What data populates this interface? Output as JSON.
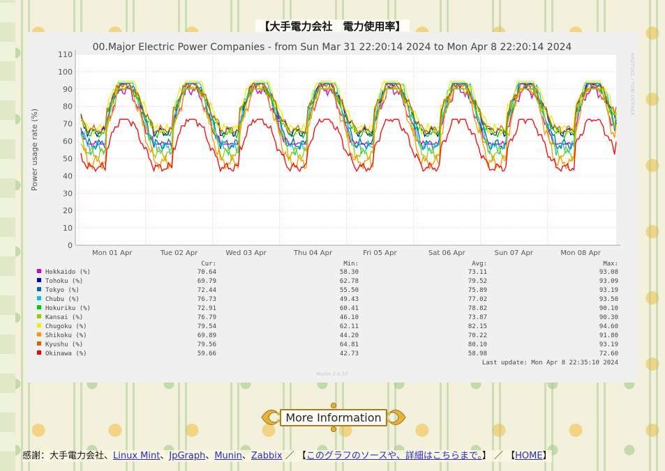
{
  "page": {
    "title": "【大手電力会社　電力使用率】",
    "more_info_label": "More Information"
  },
  "footer": {
    "thanks_label": "感謝：大手電力会社、",
    "links": [
      "Linux Mint",
      "JpGraph",
      "Munin",
      "Zabbix"
    ],
    "separator": "、",
    "slash": " ／ ",
    "source_link": "このグラフのソースや、詳細はこちらまで。",
    "home_link": "HOME",
    "bracket_open": "【",
    "bracket_close": "】"
  },
  "chart_data": {
    "type": "line",
    "title": "00.Major Electric Power Companies - from Sun Mar 31 22:20:14 2024 to Mon Apr  8 22:20:14 2024",
    "xlabel": "",
    "ylabel": "Power usage rate (%)",
    "ylim": [
      0,
      110
    ],
    "yticks": [
      0,
      10,
      20,
      30,
      40,
      50,
      60,
      70,
      80,
      90,
      100,
      110
    ],
    "xticks": [
      "Mon 01 Apr",
      "Tue 02 Apr",
      "Wed 03 Apr",
      "Thu 04 Apr",
      "Fri 05 Apr",
      "Sat 06 Apr",
      "Sun 07 Apr",
      "Mon 08 Apr"
    ],
    "grid": true,
    "side_label": "RRDTOOL / TOBI OETIKER",
    "footer_label": "Munin 2.0.57",
    "legend_headers": [
      "Cur:",
      "Min:",
      "Avg:",
      "Max:"
    ],
    "last_update": "Last update: Mon Apr  8 22:35:10 2024",
    "series": [
      {
        "name": "Hokkaido (%)",
        "color": "#cc00cc",
        "cur": "70.64",
        "min": "58.30",
        "avg": "73.11",
        "max": "93.08"
      },
      {
        "name": "Tohoku (%)",
        "color": "#0000cc",
        "cur": "69.79",
        "min": "62.78",
        "avg": "79.52",
        "max": "93.09"
      },
      {
        "name": "Tokyo (%)",
        "color": "#0066b3",
        "cur": "72.44",
        "min": "55.50",
        "avg": "75.89",
        "max": "93.19"
      },
      {
        "name": "Chubu (%)",
        "color": "#00cccc",
        "cur": "76.73",
        "min": "49.43",
        "avg": "77.02",
        "max": "93.50"
      },
      {
        "name": "Hokuriku (%)",
        "color": "#00cc00",
        "cur": "72.91",
        "min": "60.41",
        "avg": "78.82",
        "max": "90.10"
      },
      {
        "name": "Kansai (%)",
        "color": "#99cc00",
        "cur": "76.79",
        "min": "46.10",
        "avg": "73.87",
        "max": "90.30"
      },
      {
        "name": "Chugoku (%)",
        "color": "#eeee00",
        "cur": "79.54",
        "min": "62.11",
        "avg": "82.15",
        "max": "94.60"
      },
      {
        "name": "Shikoku (%)",
        "color": "#ff9900",
        "cur": "69.89",
        "min": "44.20",
        "avg": "70.22",
        "max": "91.80"
      },
      {
        "name": "Kyushu (%)",
        "color": "#cc6600",
        "cur": "79.56",
        "min": "64.81",
        "avg": "80.10",
        "max": "93.19"
      },
      {
        "name": "Okinawa (%)",
        "color": "#ff0000",
        "cur": "59.66",
        "min": "42.73",
        "avg": "58.98",
        "max": "72.60"
      }
    ]
  }
}
